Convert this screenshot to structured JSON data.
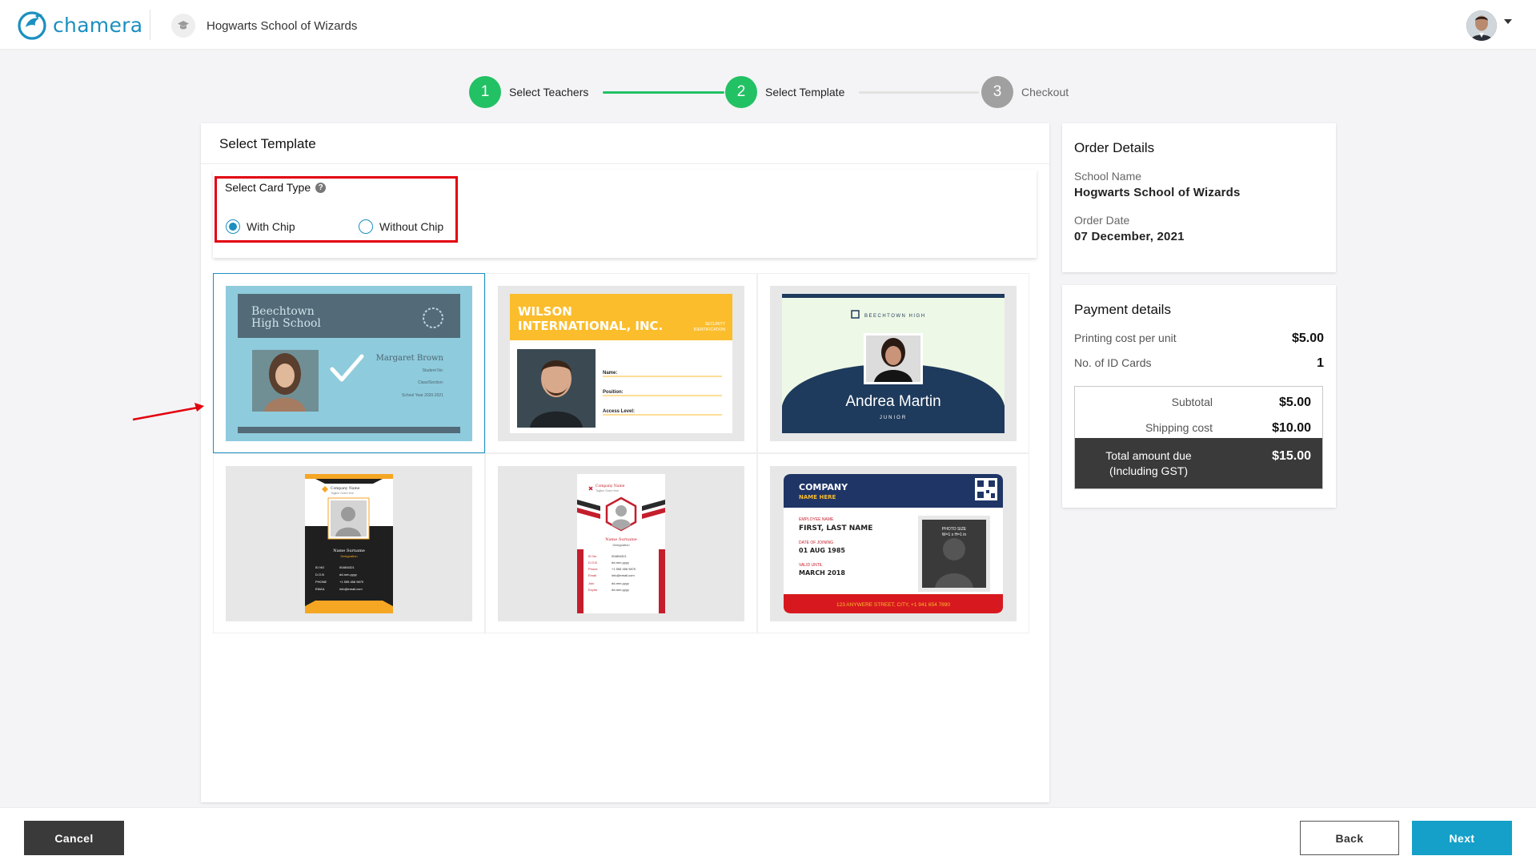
{
  "header": {
    "logo_text": "chamera",
    "school_name": "Hogwarts School of Wizards"
  },
  "stepper": {
    "steps": [
      {
        "number": "1",
        "label": "Select Teachers",
        "state": "done"
      },
      {
        "number": "2",
        "label": "Select Template",
        "state": "current"
      },
      {
        "number": "3",
        "label": "Checkout",
        "state": "todo"
      }
    ]
  },
  "main": {
    "title": "Select Template",
    "card_type": {
      "label": "Select Card Type",
      "help_glyph": "?",
      "options": [
        {
          "label": "With Chip",
          "selected": true
        },
        {
          "label": "Without Chip",
          "selected": false
        }
      ]
    },
    "templates": [
      {
        "name": "Beechtown High School",
        "selected": true,
        "school_line1": "Beechtown",
        "school_line2": "High School",
        "person": "Margaret Brown",
        "lines": [
          "Student No:",
          "Class/Section:",
          "School Year 2020-2021"
        ]
      },
      {
        "name": "Wilson International",
        "selected": false,
        "company_line1": "WILSON",
        "company_line2": "INTERNATIONAL, INC.",
        "badge_line1": "SECURITY",
        "badge_line2": "IDENTIFICATION",
        "fields": [
          "Name:",
          "Position:",
          "Access Level:"
        ]
      },
      {
        "name": "Beechtown High Andrea Martin",
        "selected": false,
        "school": "BEECHTOWN HIGH",
        "person": "Andrea Martin",
        "role": "JUNIOR"
      },
      {
        "name": "Company Vertical Orange",
        "selected": false,
        "company": "Company Name",
        "tagline": "Tagline Goes Here",
        "person": "Name Surname",
        "designation": "Designation",
        "rows": [
          [
            "ID NO",
            "00AB4321"
          ],
          [
            "D.O.B",
            "dd-mm-yyyy"
          ],
          [
            "PHONE",
            "+1 555 456 9870"
          ],
          [
            "EMAIL",
            "info@email.com"
          ]
        ]
      },
      {
        "name": "Company Vertical Red",
        "selected": false,
        "company": "Company Name",
        "tagline": "Tagline Goes Here",
        "person": "Name Surname",
        "designation": "Designation",
        "rows": [
          [
            "ID No",
            "00AB4321"
          ],
          [
            "D.O.B",
            "dd-mm-yyyy"
          ],
          [
            "Phone",
            "+1 555 456 9870"
          ],
          [
            "Email",
            "info@email.com"
          ],
          [
            "Join",
            "dd-mm-yyyy"
          ],
          [
            "Expire",
            "dd-mm-yyyy"
          ]
        ]
      },
      {
        "name": "Company Horizontal Navy",
        "selected": false,
        "company": "COMPANY",
        "company_sub": "NAME HERE",
        "employee_label": "EMPLOYEE NAME",
        "employee": "FIRST, LAST NAME",
        "joining_label": "DATE OF JOINING",
        "joining": "01 AUG 1985",
        "valid_label": "VALID UNTIL",
        "valid": "MARCH 2018",
        "photo_line1": "PHOTO SIZE",
        "photo_line2": "W=1 x H=1 in",
        "address": "123 ANYWERE STREET, CITY, +1 941 654 7890"
      }
    ]
  },
  "order_details": {
    "title": "Order Details",
    "school_label": "School Name",
    "school_value": "Hogwarts School of Wizards",
    "date_label": "Order Date",
    "date_value": "07 December, 2021"
  },
  "payment": {
    "title": "Payment details",
    "unit_cost_label": "Printing cost per unit",
    "unit_cost_value": "$5.00",
    "count_label": "No. of ID Cards",
    "count_value": "1",
    "subtotal_label": "Subtotal",
    "subtotal_value": "$5.00",
    "shipping_label": "Shipping cost",
    "shipping_value": "$10.00",
    "total_label_line1": "Total amount due",
    "total_label_line2": "(Including GST)",
    "total_value": "$15.00"
  },
  "footer": {
    "cancel_label": "Cancel",
    "back_label": "Back",
    "next_label": "Next"
  },
  "colors": {
    "brand": "#1b8fbf",
    "step_done": "#22c164",
    "step_todo": "#a0a0a0",
    "highlight_box": "#e3000f",
    "next_button": "#14a0c8",
    "dark_button": "#3a3a3a"
  }
}
